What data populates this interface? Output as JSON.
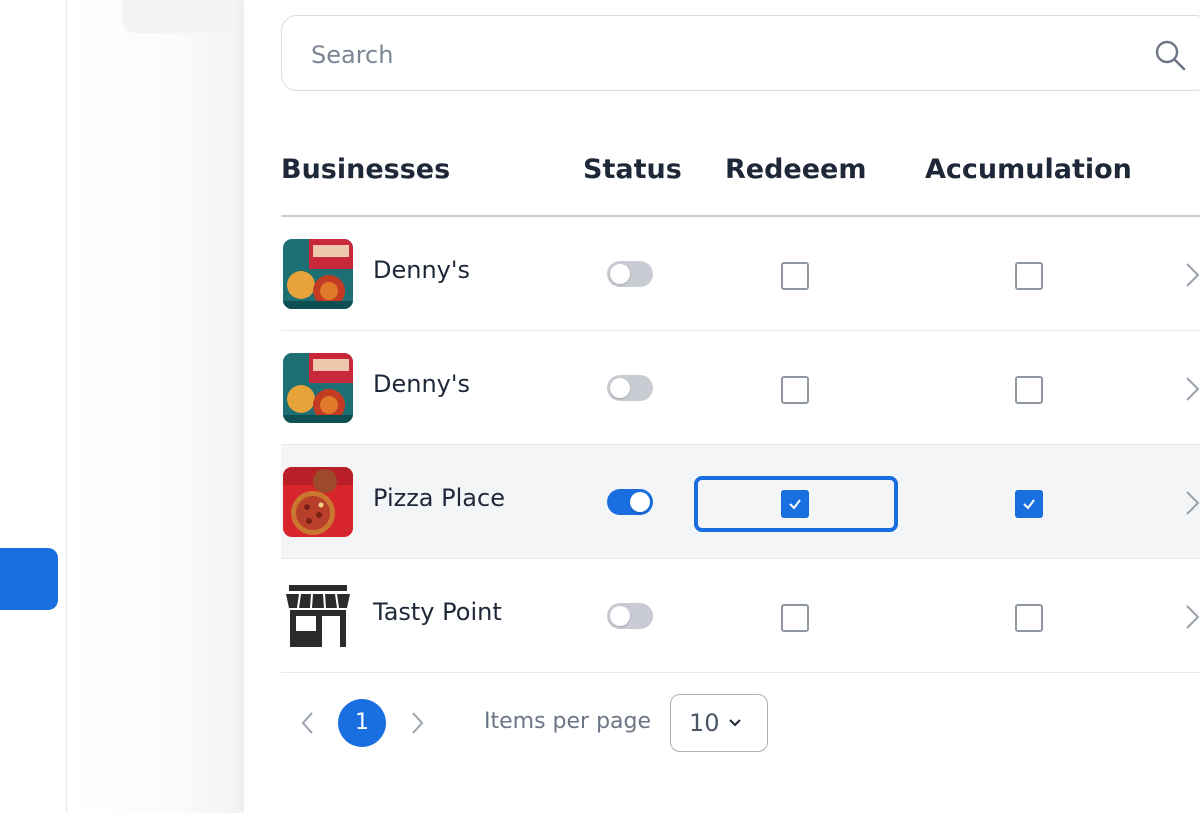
{
  "search": {
    "placeholder": "Search"
  },
  "table": {
    "headers": {
      "businesses": "Businesses",
      "status": "Status",
      "redeem": "Redeeem",
      "accumulation": "Accumulation"
    },
    "rows": [
      {
        "name": "Denny's",
        "thumbnail": "dennys-food-photo",
        "status_on": false,
        "redeem_checked": false,
        "accumulation_checked": false
      },
      {
        "name": "Denny's",
        "thumbnail": "dennys-food-photo",
        "status_on": false,
        "redeem_checked": false,
        "accumulation_checked": false
      },
      {
        "name": "Pizza Place",
        "thumbnail": "pizza-photo",
        "status_on": true,
        "redeem_checked": true,
        "accumulation_checked": true
      },
      {
        "name": "Tasty Point",
        "thumbnail": "storefront-icon",
        "status_on": false,
        "redeem_checked": false,
        "accumulation_checked": false
      }
    ]
  },
  "pagination": {
    "current_page": "1",
    "items_per_page_label": "Items per page",
    "items_per_page_value": "10"
  },
  "colors": {
    "accent": "#1a6fe0",
    "text": "#1e2838",
    "muted": "#6b7585"
  }
}
